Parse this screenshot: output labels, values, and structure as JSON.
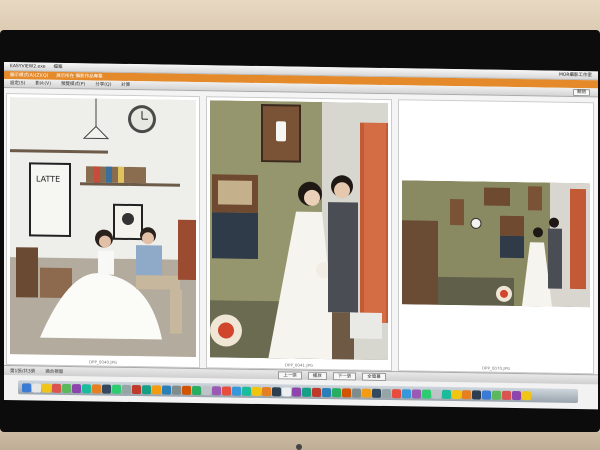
{
  "app": {
    "menu_items": [
      "EASYVIEW2.exe",
      "檔案"
    ],
    "menu_right": [
      "MOR攝影工作室"
    ],
    "title_items": [
      "顯示模式(A)(Z)(Q)",
      "展示所在 攝影作品專業"
    ],
    "toolbar_items": [
      "設定(S)",
      "影片(V)",
      "預覽模式(P)",
      "分享(Q)",
      "計算"
    ],
    "toolbar_right": "關閉"
  },
  "photos": [
    {
      "caption": "DPP_0040.JPG",
      "description": "cafe couple"
    },
    {
      "caption": "DPP_0041.JPG",
      "description": "olive wall couple"
    },
    {
      "caption": "DPP_0070.JPG",
      "description": "wide room couple"
    }
  ],
  "status": {
    "left": "第1張/共3張",
    "zoom_label": "適合視窗",
    "buttons": [
      "上一張",
      "播放",
      "下一張",
      "全螢幕"
    ]
  },
  "dock_colors": [
    "#3a7bd5",
    "#e6e6e6",
    "#f0c419",
    "#d9534f",
    "#5cb85c",
    "#8e44ad",
    "#1abc9c",
    "#e67e22",
    "#34495e",
    "#2ecc71",
    "#95a5a6",
    "#c0392b",
    "#16a085",
    "#f39c12",
    "#2980b9",
    "#7f8c8d",
    "#d35400",
    "#27ae60",
    "#bdc3c7",
    "#9b59b6",
    "#e74c3c",
    "#3498db",
    "#1abc9c",
    "#f1c40f",
    "#e67e22",
    "#2c3e50",
    "#ecf0f1",
    "#8e44ad",
    "#16a085",
    "#c0392b",
    "#2980b9",
    "#27ae60",
    "#d35400",
    "#7f8c8d",
    "#f39c12",
    "#34495e",
    "#95a5a6",
    "#e74c3c",
    "#3498db",
    "#9b59b6",
    "#2ecc71",
    "#bdc3c7",
    "#1abc9c",
    "#f1c40f",
    "#e67e22",
    "#2c3e50",
    "#3a7bd5",
    "#5cb85c",
    "#d9534f",
    "#8e44ad",
    "#f0c419"
  ]
}
